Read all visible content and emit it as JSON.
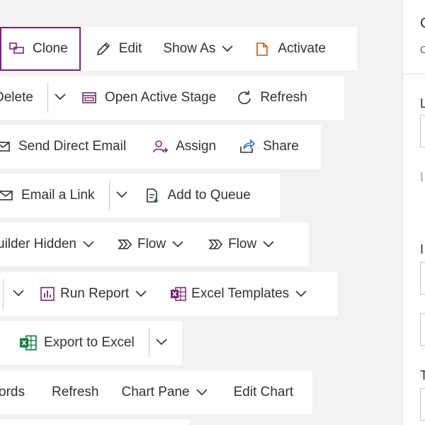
{
  "rows": [
    {
      "items": [
        {
          "label": "Clone",
          "icon": "clone-icon"
        },
        {
          "label": "Edit",
          "icon": "pencil-icon"
        },
        {
          "label": "Show As",
          "chevron": true
        },
        {
          "label": "Activate",
          "icon": "activate-icon"
        }
      ]
    },
    {
      "items": [
        {
          "label": "Delete"
        },
        {
          "label": "Open Active Stage",
          "icon": "active-stage-icon"
        },
        {
          "label": "Refresh",
          "icon": "refresh-icon"
        }
      ]
    },
    {
      "items": [
        {
          "label": "Send Direct Email",
          "icon": "email-icon"
        },
        {
          "label": "Assign",
          "icon": "assign-icon"
        },
        {
          "label": "Share",
          "icon": "share-icon"
        }
      ]
    },
    {
      "items": [
        {
          "label": "Email a Link",
          "icon": "email-link-icon"
        },
        {
          "label": "Add to Queue",
          "icon": "queue-icon"
        }
      ]
    },
    {
      "items": [
        {
          "label": "uilder Hidden",
          "chevron": true
        },
        {
          "label": "Flow",
          "icon": "flow-icon",
          "chevron": true
        },
        {
          "label": "Flow",
          "icon": "flow-icon",
          "chevron": true
        }
      ]
    },
    {
      "items": [
        {
          "label": "Run Report",
          "icon": "report-icon",
          "chevron": true
        },
        {
          "label": "Excel Templates",
          "icon": "excel-templates-icon",
          "chevron": true
        }
      ]
    },
    {
      "items": [
        {
          "label": "Export to Excel",
          "icon": "excel-icon"
        }
      ]
    },
    {
      "items": [
        {
          "label": "ords"
        },
        {
          "label": "Refresh"
        },
        {
          "label": "Chart Pane",
          "chevron": true
        },
        {
          "label": "Edit Chart"
        }
      ]
    }
  ],
  "right_panel": {
    "top_letter": "C",
    "sub_letter": "C",
    "label_l": "L",
    "label_i_muted": "I",
    "label_i": "I",
    "label_t": "T"
  },
  "colors": {
    "accent": "#742774",
    "excel_green": "#107c41",
    "background": "#f3f2f1"
  }
}
